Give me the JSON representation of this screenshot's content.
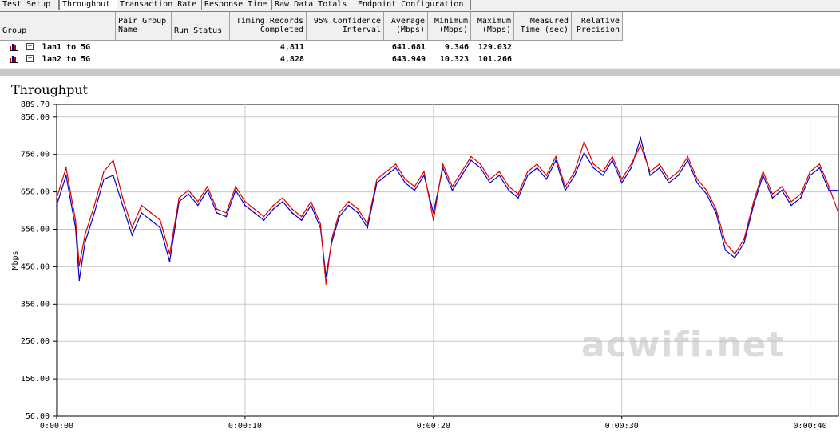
{
  "tabs": [
    "Test Setup",
    "Throughput",
    "Transaction Rate",
    "Response Time",
    "Raw Data Totals",
    "Endpoint Configuration"
  ],
  "table": {
    "headers": [
      "Group",
      "Pair Group\nName",
      "Run Status",
      "Timing Records\nCompleted",
      "95% Confidence\nInterval",
      "Average\n(Mbps)",
      "Minimum\n(Mbps)",
      "Maximum\n(Mbps)",
      "Measured\nTime (sec)",
      "Relative\nPrecision"
    ],
    "rows": [
      {
        "name": "lan1 to 5G",
        "records": "4,811",
        "average": "641.681",
        "minimum": "9.346",
        "maximum": "129.032"
      },
      {
        "name": "lan2 to 5G",
        "records": "4,828",
        "average": "643.949",
        "minimum": "10.323",
        "maximum": "101.266"
      }
    ]
  },
  "chart": {
    "title": "Throughput",
    "ylabel": "Mbps",
    "watermark": "acwifi.net"
  },
  "chart_data": {
    "type": "line",
    "title": "Throughput",
    "ylabel": "Mbps",
    "xlabel": "",
    "ylim": [
      56.0,
      889.7
    ],
    "yticks": [
      "889.70",
      "856.00",
      "756.00",
      "656.00",
      "556.00",
      "456.00",
      "356.00",
      "256.00",
      "156.00",
      "56.00"
    ],
    "xticks": [
      "0:00:00",
      "0:00:10",
      "0:00:20",
      "0:00:30",
      "0:00:40"
    ],
    "xlim_seconds": [
      0,
      41.5
    ],
    "grid": true,
    "series": [
      {
        "color": "#0000cc",
        "x": [
          0,
          0.5,
          1,
          1.2,
          1.5,
          2,
          2.5,
          3,
          3.5,
          4,
          4.5,
          5,
          5.5,
          6,
          6.5,
          7,
          7.5,
          8,
          8.5,
          9,
          9.5,
          10,
          10.5,
          11,
          11.5,
          12,
          12.5,
          13,
          13.5,
          14,
          14.3,
          14.6,
          15,
          15.5,
          16,
          16.5,
          17,
          17.5,
          18,
          18.5,
          19,
          19.5,
          20,
          20.5,
          21,
          21.5,
          22,
          22.5,
          23,
          23.5,
          24,
          24.5,
          25,
          25.5,
          26,
          26.5,
          27,
          27.5,
          28,
          28.5,
          29,
          29.5,
          30,
          30.5,
          31,
          31.5,
          32,
          32.5,
          33,
          33.5,
          34,
          34.5,
          35,
          35.5,
          36,
          36.5,
          37,
          37.5,
          38,
          38.5,
          39,
          39.5,
          40,
          40.5,
          41,
          41.5
        ],
        "values": [
          620,
          700,
          560,
          420,
          520,
          600,
          690,
          700,
          620,
          540,
          600,
          580,
          560,
          470,
          630,
          650,
          620,
          660,
          600,
          590,
          660,
          620,
          600,
          580,
          610,
          630,
          600,
          580,
          620,
          560,
          430,
          520,
          590,
          620,
          600,
          560,
          680,
          700,
          720,
          680,
          660,
          700,
          600,
          720,
          660,
          700,
          740,
          720,
          680,
          700,
          660,
          640,
          700,
          720,
          690,
          740,
          660,
          700,
          760,
          720,
          700,
          740,
          680,
          720,
          800,
          700,
          720,
          680,
          700,
          740,
          680,
          650,
          600,
          500,
          480,
          520,
          620,
          700,
          640,
          660,
          620,
          640,
          700,
          720,
          660,
          660
        ]
      },
      {
        "color": "#dd0000",
        "x": [
          0,
          0.5,
          1,
          1.2,
          1.5,
          2,
          2.5,
          3,
          3.5,
          4,
          4.5,
          5,
          5.5,
          6,
          6.5,
          7,
          7.5,
          8,
          8.5,
          9,
          9.5,
          10,
          10.5,
          11,
          11.5,
          12,
          12.5,
          13,
          13.5,
          14,
          14.3,
          14.6,
          15,
          15.5,
          16,
          16.5,
          17,
          17.5,
          18,
          18.5,
          19,
          19.5,
          20,
          20.5,
          21,
          21.5,
          22,
          22.5,
          23,
          23.5,
          24,
          24.5,
          25,
          25.5,
          26,
          26.5,
          27,
          27.5,
          28,
          28.5,
          29,
          29.5,
          30,
          30.5,
          31,
          31.5,
          32,
          32.5,
          33,
          33.5,
          34,
          34.5,
          35,
          35.5,
          36,
          36.5,
          37,
          37.5,
          38,
          38.5,
          39,
          39.5,
          40,
          40.5,
          41,
          41.5
        ],
        "values": [
          640,
          720,
          580,
          460,
          540,
          620,
          710,
          740,
          640,
          560,
          620,
          600,
          580,
          490,
          640,
          660,
          630,
          670,
          610,
          600,
          670,
          630,
          610,
          590,
          620,
          640,
          610,
          590,
          630,
          570,
          410,
          530,
          600,
          630,
          610,
          570,
          690,
          710,
          730,
          690,
          670,
          710,
          580,
          730,
          670,
          710,
          750,
          730,
          690,
          710,
          670,
          650,
          710,
          730,
          700,
          750,
          670,
          710,
          790,
          730,
          710,
          750,
          690,
          730,
          780,
          710,
          730,
          690,
          710,
          750,
          690,
          660,
          610,
          520,
          490,
          530,
          630,
          710,
          650,
          670,
          630,
          650,
          710,
          730,
          670,
          600
        ]
      }
    ]
  }
}
